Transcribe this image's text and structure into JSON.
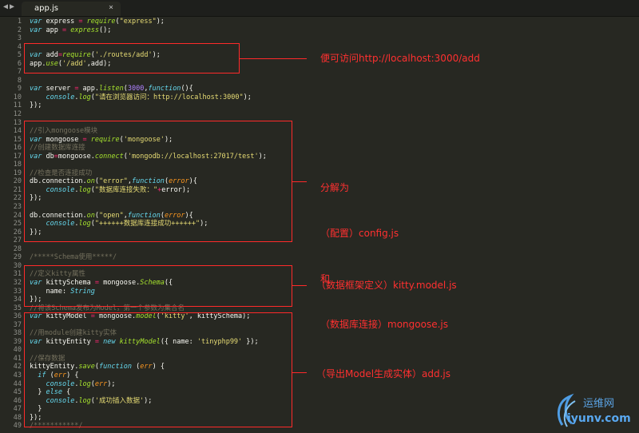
{
  "window": {
    "nav_back_label": "◀",
    "nav_forward_label": "▶",
    "tab_title": "app.js",
    "tab_close_label": "×"
  },
  "editor": {
    "line_numbers": [
      "1",
      "2",
      "3",
      "4",
      "5",
      "6",
      "7",
      "8",
      "9",
      "10",
      "11",
      "12",
      "13",
      "14",
      "15",
      "16",
      "17",
      "18",
      "19",
      "20",
      "21",
      "22",
      "23",
      "24",
      "25",
      "26",
      "27",
      "28",
      "29",
      "30",
      "31",
      "32",
      "33",
      "34",
      "35",
      "36",
      "37",
      "38",
      "39",
      "40",
      "41",
      "42",
      "43",
      "44",
      "45",
      "46",
      "47",
      "48",
      "49"
    ],
    "lines": [
      "var express = require(\"express\");",
      "var app = express();",
      "",
      "",
      "var add=require('./routes/add');",
      "app.use('/add',add);",
      "",
      "",
      "var server = app.listen(3000,function(){",
      "    console.log(\"请在浏览器访问：http://localhost:3000\");",
      "});",
      "",
      "",
      "//引入mongoose模块",
      "var mongoose = require('mongoose');",
      "//创建数据库连接",
      "var db=mongoose.connect('mongodb://localhost:27017/test');",
      "",
      "//检查是否连接成功",
      "db.connection.on(\"error\",function(error){",
      "    console.log(\"数据库连接失败：\"+error);",
      "});",
      "",
      "db.connection.on(\"open\",function(error){",
      "    console.log(\"++++++数据库连接成功++++++\");",
      "});",
      "",
      "",
      "/*****Schema使用*****/",
      "",
      "//定义kitty属性",
      "var kittySchema = mongoose.Schema({",
      "    name: String",
      "});",
      "//将该Schema发布为Model，第一个参数为集合名",
      "var kittyModel = mongoose.model('kitty', kittySchema);",
      "",
      "//用module创建kitty实体",
      "var kittyEntity = new kittyModel({ name: 'tinyphp99' });",
      "",
      "//保存数据",
      "kittyEntity.save(function (err) {",
      "  if (err) {",
      "    console.log(err);",
      "  } else {",
      "    console.log('成功插入数据');",
      "  }",
      "});",
      "/***********/"
    ]
  },
  "annotations": {
    "route_note": "便可访问http://localhost:3000/add",
    "split_note_1": "分解为",
    "split_note_2": "（配置）config.js",
    "split_note_3": "和",
    "split_note_4": "（数据库连接）mongoose.js",
    "schema_note": "（数据框架定义）kitty.model.js",
    "model_note": "（导出Model生成实体）add.js",
    "highlight_color": "#ff2a2a"
  },
  "watermark": {
    "site_name": "运维网",
    "domain": "iyunv.com"
  },
  "syntax_colors": {
    "background": "#272822",
    "keyword": "#66d9ef",
    "string": "#e6db74",
    "number": "#ae81ff",
    "function": "#a6e22e",
    "comment": "#75715e",
    "operator": "#f92672"
  }
}
